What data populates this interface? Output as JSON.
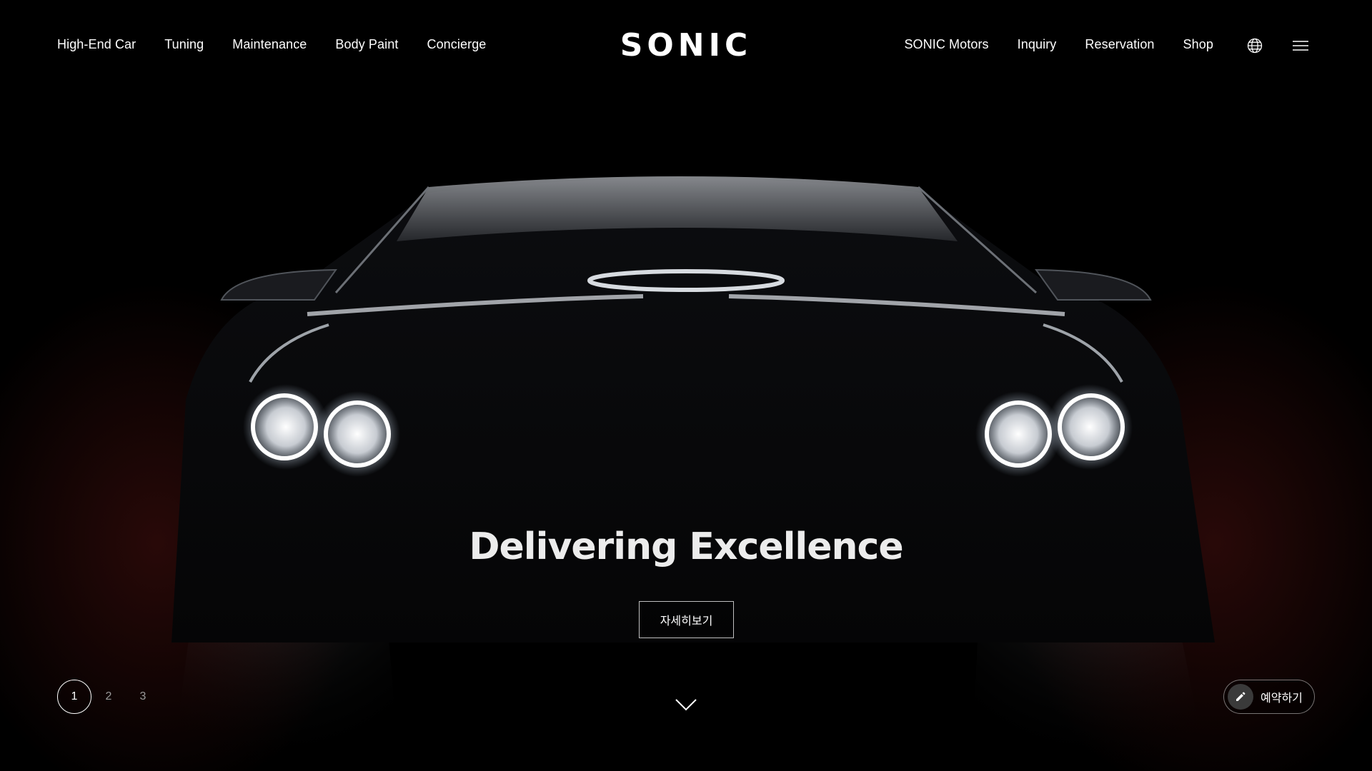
{
  "header": {
    "logo": "SONIC",
    "nav_left": [
      {
        "label": "High-End Car"
      },
      {
        "label": "Tuning"
      },
      {
        "label": "Maintenance"
      },
      {
        "label": "Body Paint"
      },
      {
        "label": "Concierge"
      }
    ],
    "nav_right": [
      {
        "label": "SONIC Motors"
      },
      {
        "label": "Inquiry"
      },
      {
        "label": "Reservation"
      },
      {
        "label": "Shop"
      }
    ],
    "icons": {
      "language": "globe-icon",
      "menu": "hamburger-menu-icon"
    }
  },
  "hero": {
    "headline": "Delivering Excellence",
    "detail_button": "자세히보기",
    "background": "dark-car-front-headlights",
    "scroll_icon": "chevron-down-icon"
  },
  "pager": {
    "pages": [
      "1",
      "2",
      "3"
    ],
    "active": "1"
  },
  "reserve": {
    "label": "예약하기",
    "icon": "pencil-icon"
  },
  "colors": {
    "background": "#000000",
    "text": "#ffffff",
    "inactive_page": "#9a9a9a",
    "reserve_icon_bg": "#3a3a3a"
  }
}
